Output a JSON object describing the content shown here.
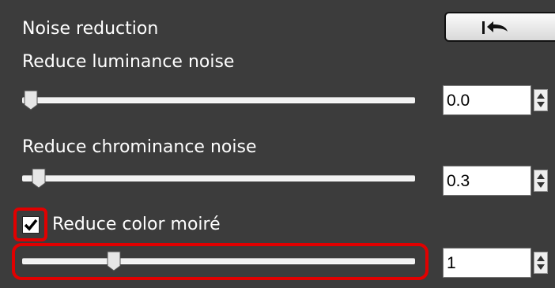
{
  "panel": {
    "title": "Noise reduction",
    "reset_button": {
      "icon": "reset-arrow-icon"
    }
  },
  "luminance": {
    "label": "Reduce luminance noise",
    "value": "0.0",
    "slider_fraction": 0.0
  },
  "chrominance": {
    "label": "Reduce chrominance noise",
    "value": "0.3",
    "slider_fraction": 0.02
  },
  "moire": {
    "label": "Reduce color moiré",
    "checked": true,
    "value": "1",
    "slider_fraction": 0.22
  },
  "colors": {
    "panel_bg": "#3c3c3c",
    "highlight": "#e10000"
  }
}
